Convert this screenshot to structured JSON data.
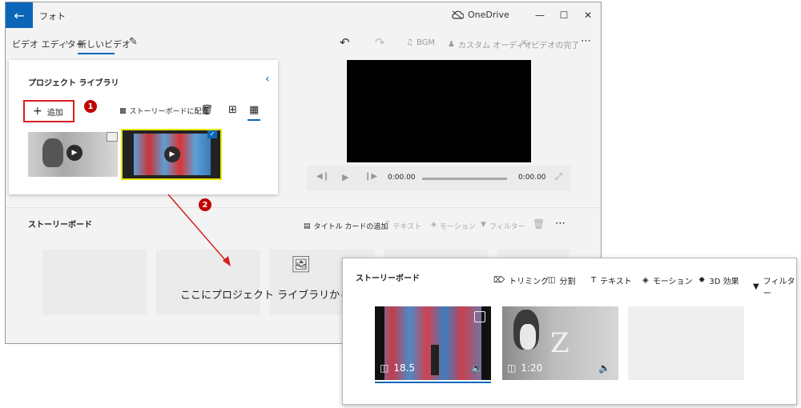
{
  "window": {
    "app_title": "フォト",
    "onedrive_label": "OneDrive",
    "back_icon": "arrow-left-icon",
    "controls": [
      "minimize",
      "maximize",
      "close"
    ]
  },
  "toolbar": {
    "breadcrumb_parent": "ビデオ エディター",
    "breadcrumb_current": "新しいビデオ",
    "bgm_label": "BGM",
    "custom_audio_label": "カスタム オーディオ",
    "finish_video_label": "ビデオの完了"
  },
  "library": {
    "title": "プロジェクト ライブラリ",
    "add_label": "追加",
    "place_in_storyboard_label": "ストーリーボードに配置"
  },
  "preview": {
    "current_time": "0:00.00",
    "total_time": "0:00.00",
    "progress": 0
  },
  "storyboard": {
    "title": "ストーリーボード",
    "add_title_card_label": "タイトル カードの追加",
    "text_label": "テキスト",
    "motion_label": "モーション",
    "filter_label": "フィルター",
    "drop_hint": "ここにプロジェクト ライブラリから項目を"
  },
  "annotations": {
    "step1": "1",
    "step2": "2",
    "highlight_color": "#d62020",
    "selection_color": "#e6e600"
  },
  "zoomed_storyboard": {
    "title": "ストーリーボード",
    "trimming_label": "トリミング",
    "split_label": "分割",
    "text_label": "テキスト",
    "motion_label": "モーション",
    "effects_3d_label": "3D 効果",
    "filter_label": "フィルター",
    "clips": [
      {
        "duration": "18.5",
        "selected": true
      },
      {
        "duration": "1:20",
        "selected": false
      }
    ]
  },
  "colors": {
    "accent": "#0b66b9",
    "window_bg": "#f3f3f3",
    "annotation_red": "#d62020"
  }
}
